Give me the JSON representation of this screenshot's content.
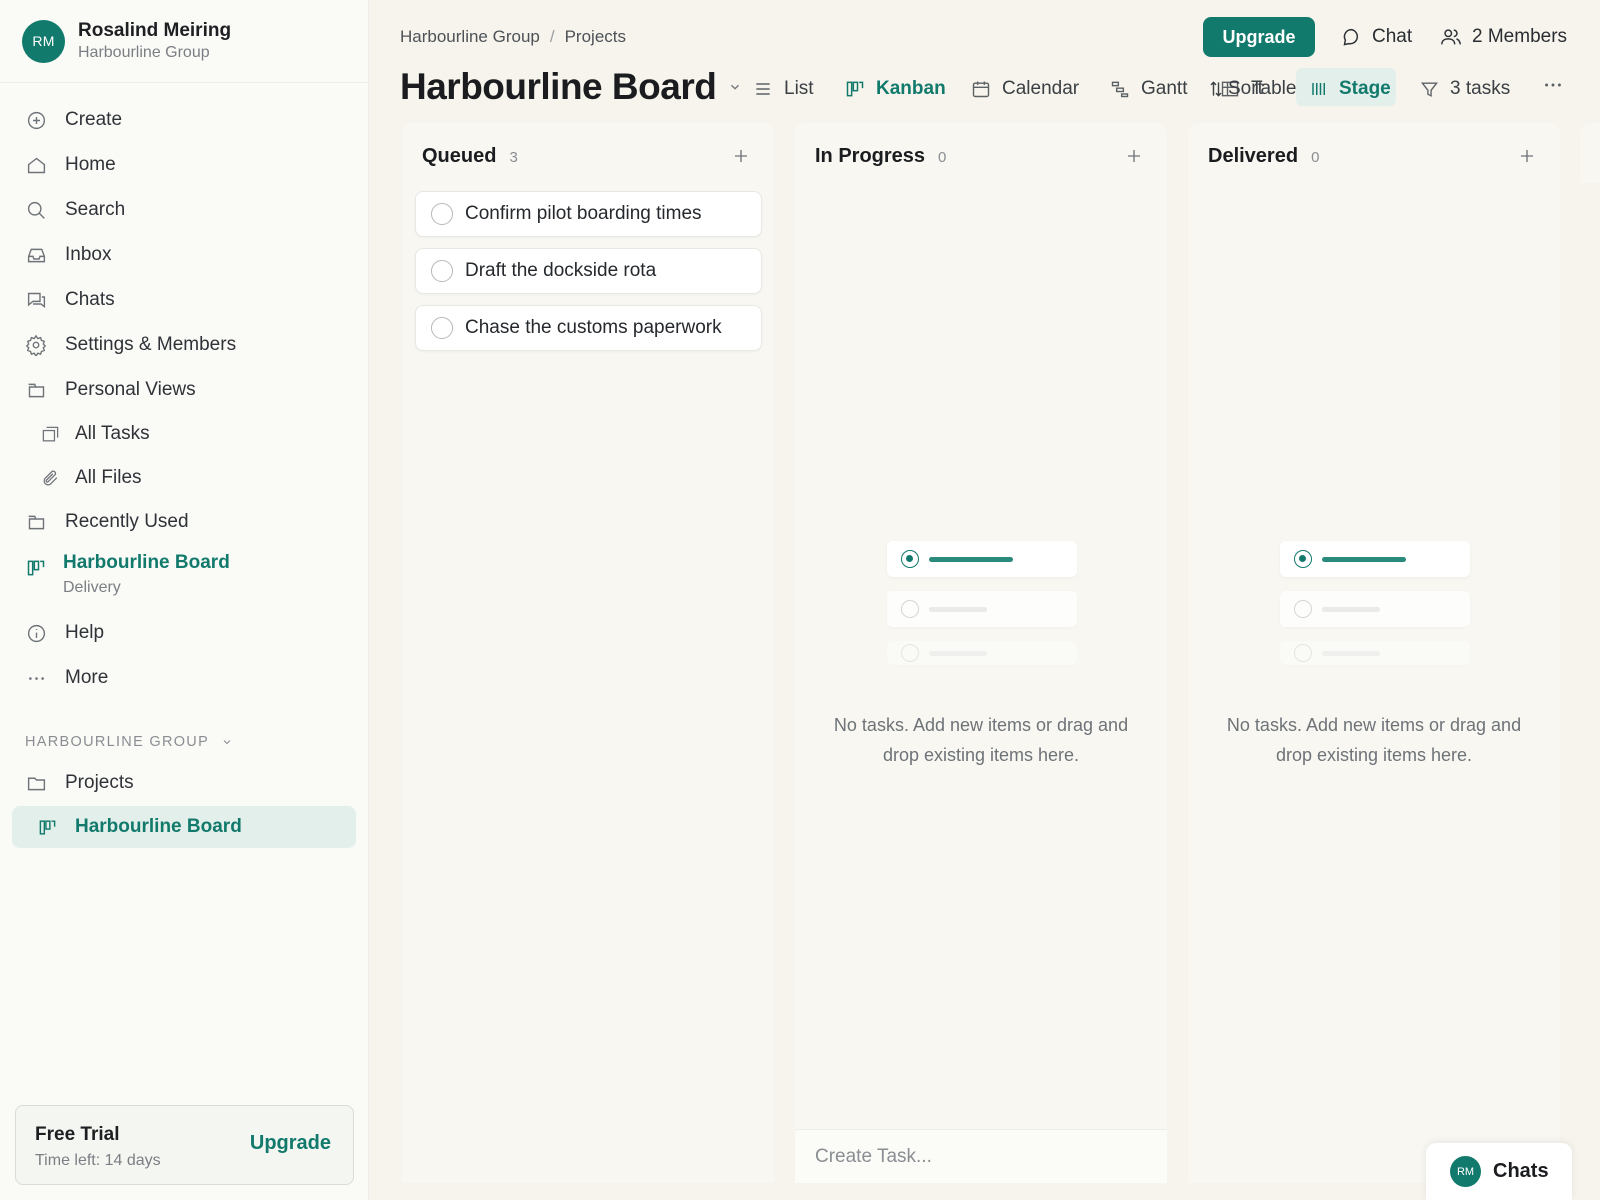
{
  "user": {
    "initials": "RM",
    "name": "Rosalind Meiring",
    "org": "Harbourline Group"
  },
  "sidebar": {
    "items": [
      {
        "label": "Create"
      },
      {
        "label": "Home"
      },
      {
        "label": "Search"
      },
      {
        "label": "Inbox"
      },
      {
        "label": "Chats"
      },
      {
        "label": "Settings & Members"
      },
      {
        "label": "Personal Views"
      },
      {
        "label": "All Tasks"
      },
      {
        "label": "All Files"
      },
      {
        "label": "Recently Used"
      }
    ],
    "board": {
      "label": "Harbourline Board",
      "sub": "Delivery"
    },
    "help": "Help",
    "more": "More",
    "section": "HARBOURLINE GROUP",
    "projects": "Projects",
    "active": "Harbourline Board",
    "trial": {
      "title": "Free Trial",
      "sub": "Time left: 14 days",
      "button": "Upgrade"
    }
  },
  "header": {
    "breadcrumb": [
      "Harbourline Group",
      "Projects"
    ],
    "upgrade": "Upgrade",
    "chat": "Chat",
    "members": "2 Members",
    "title": "Harbourline Board",
    "views": [
      {
        "label": "List"
      },
      {
        "label": "Kanban"
      },
      {
        "label": "Calendar"
      },
      {
        "label": "Gantt"
      },
      {
        "label": "Table"
      },
      {
        "label": "Sort"
      },
      {
        "label": "Stage"
      }
    ],
    "filter": "3 tasks"
  },
  "columns": [
    {
      "title": "Queued",
      "count": "3",
      "tasks": [
        "Confirm pilot boarding times",
        "Draft the dockside rota",
        "Chase the customs paperwork"
      ]
    },
    {
      "title": "In Progress",
      "count": "0",
      "empty": "No tasks. Add new items or drag and drop existing items here.",
      "create_placeholder": "Create Task..."
    },
    {
      "title": "Delivered",
      "count": "0",
      "empty": "No tasks. Add new items or drag and drop existing items here."
    }
  ],
  "chats_widget": {
    "initials": "RM",
    "label": "Chats"
  },
  "colors": {
    "accent": "#127a6c",
    "accent_soft": "#e3efea"
  }
}
